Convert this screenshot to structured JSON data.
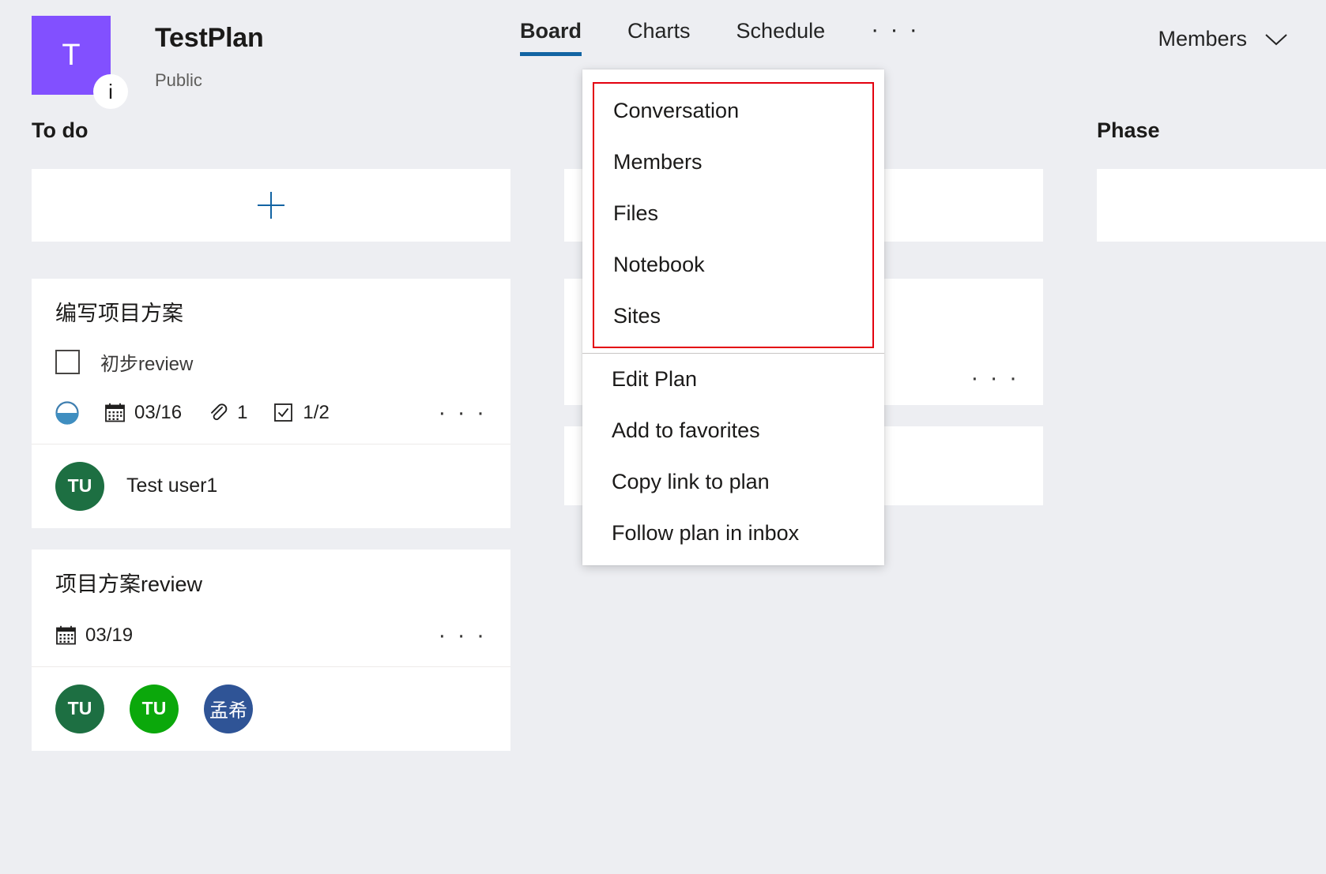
{
  "header": {
    "plan_icon_letter": "T",
    "plan_info_badge": "i",
    "plan_title": "TestPlan",
    "plan_visibility": "Public",
    "tabs": [
      {
        "label": "Board",
        "active": true
      },
      {
        "label": "Charts",
        "active": false
      },
      {
        "label": "Schedule",
        "active": false
      }
    ],
    "tab_overflow": "· · ·",
    "members_label": "Members",
    "members_chevron": "chevron-down-icon",
    "accent_color": "#1264a3",
    "plan_icon_color": "#8250ff"
  },
  "board": {
    "buckets": [
      {
        "title": "To do",
        "add_task_label": "+",
        "tasks": [
          {
            "title": "编写项目方案",
            "checklist_item": "初步review",
            "progress_state": "in-progress",
            "due_date": "03/16",
            "attachment_count": "1",
            "checklist_count": "1/2",
            "ellipsis": "· · ·",
            "assignees": [
              {
                "initials": "TU",
                "name": "Test user1",
                "color": "#1d6f42"
              }
            ]
          },
          {
            "title": "项目方案review",
            "due_date": "03/19",
            "ellipsis": "· · ·",
            "assignees": [
              {
                "initials": "TU",
                "color": "#1d6f42"
              },
              {
                "initials": "TU",
                "color": "#0ba80b"
              },
              {
                "initials": "孟希",
                "color": "#2f5496"
              }
            ]
          }
        ]
      },
      {
        "title": "",
        "tasks": []
      },
      {
        "title": "Phase",
        "tasks": []
      }
    ]
  },
  "dropdown": {
    "highlighted_items": [
      {
        "label": "Conversation"
      },
      {
        "label": "Members"
      },
      {
        "label": "Files"
      },
      {
        "label": "Notebook"
      },
      {
        "label": "Sites"
      }
    ],
    "highlight_color": "#e3000f",
    "items": [
      {
        "label": "Edit Plan"
      },
      {
        "label": "Add to favorites"
      },
      {
        "label": "Copy link to plan"
      },
      {
        "label": "Follow plan in inbox"
      }
    ]
  }
}
